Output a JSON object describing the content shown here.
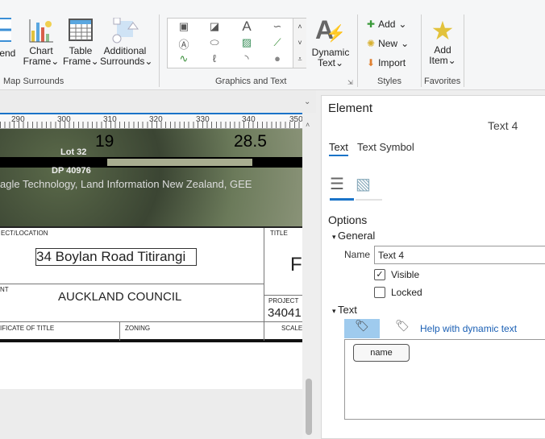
{
  "ribbon": {
    "legend_label": "gend",
    "chart_frame": [
      "Chart",
      "Frame"
    ],
    "table_frame": [
      "Table",
      "Frame"
    ],
    "additional_surrounds": [
      "Additional",
      "Surrounds"
    ],
    "group_map_surrounds": "Map Surrounds",
    "group_graphics_text": "Graphics and Text",
    "dynamic_text": [
      "Dynamic",
      "Text"
    ],
    "styles": {
      "add": "Add",
      "new": "New",
      "import": "Import"
    },
    "group_styles": "Styles",
    "add_item": [
      "Add",
      "Item"
    ],
    "group_favorites": "Favorites"
  },
  "map": {
    "ruler_ticks": [
      "290",
      "300",
      "310",
      "320",
      "330",
      "340",
      "350"
    ],
    "scale_labels": [
      "19",
      "28.5"
    ],
    "parcel_labels": [
      "Lot 32",
      "DP 40976"
    ],
    "credits": "agle Technology, Land Information New Zealand, GEE",
    "title_block": {
      "project_location_label": "ECT/LOCATION",
      "project_location_value": "34 Boylan Road Titirangi",
      "title_label": "TITLE",
      "title_value": "F",
      "client_label": "NT",
      "client_value": "AUCKLAND COUNCIL",
      "project_no_label": "PROJECT",
      "project_no_value": "34041",
      "certificate_label": "IFICATE OF TITLE",
      "zoning_label": "ZONING",
      "scale_label": "SCALE"
    }
  },
  "panel": {
    "title": "Element",
    "element_name": "Text 4",
    "tabs": [
      "Text",
      "Text Symbol"
    ],
    "options_label": "Options",
    "general_label": "General",
    "name_label": "Name",
    "name_value": "Text 4",
    "visible_label": "Visible",
    "visible_checked": true,
    "locked_label": "Locked",
    "locked_checked": false,
    "text_label": "Text",
    "help_link": "Help with dynamic text",
    "text_tag": "name"
  }
}
